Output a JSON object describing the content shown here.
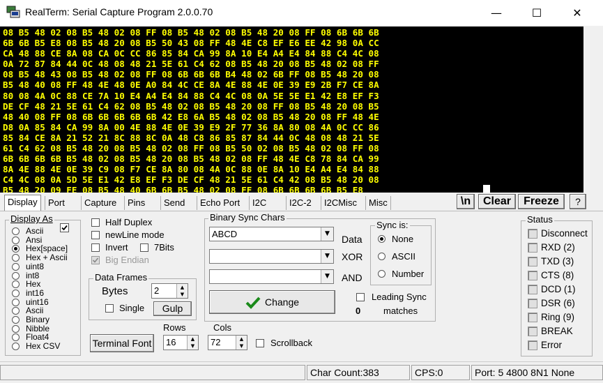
{
  "window": {
    "title": "RealTerm: Serial Capture Program 2.0.0.70",
    "minimize_glyph": "—",
    "maximize_glyph": "☐",
    "close_glyph": "✕"
  },
  "terminal": {
    "lines": [
      "08 B5 48 02 08 B5 48 02 08 FF 08 B5 48 02 08 B5 48 20 08 FF 08 6B 6B 6B",
      "6B 6B B5 E8 08 B5 48 20 08 B5 50 43 08 FF 48 4E C8 EF E6 EE 42 98 0A CC",
      "CA 48 88 CE 8A 08 CA 0C CC 86 85 84 CA 99 8A 10 E4 A4 E4 84 88 C4 4C 08",
      "0A 72 87 84 44 0C 48 08 48 21 5E 61 C4 62 08 B5 48 20 08 B5 48 02 08 FF",
      "08 B5 48 43 08 B5 48 02 08 FF 08 6B 6B 6B B4 48 02 6B FF 08 B5 48 20 08",
      "B5 48 40 08 FF 48 4E 48 0E A0 84 4C CE 8A 4E 88 4E 0E 39 E9 2B F7 CE 8A",
      "80 08 4A 0C 88 CE 7A 10 E4 A4 E4 84 88 C4 4C 08 0A 5E 5E E1 42 E8 EF F3",
      "DE CF 48 21 5E 61 C4 62 08 B5 48 02 08 B5 48 20 08 FF 08 B5 48 20 08 B5",
      "48 40 08 FF 08 6B 6B 6B 6B 6B 42 E8 6A B5 48 02 08 B5 48 20 08 FF 48 4E",
      "D8 0A 85 84 CA 99 8A 00 4E 88 4E 0E 39 E9 2F 77 36 8A 80 08 4A 0C CC 86",
      "85 84 CE 8A 21 52 21 8C 88 8C 0A 48 C8 86 85 87 84 44 0C 48 08 48 21 5E",
      "61 C4 62 08 B5 48 20 08 B5 48 02 08 FF 08 B5 50 02 08 B5 48 02 08 FF 08",
      "6B 6B 6B 6B B5 48 02 08 B5 48 20 08 B5 48 02 08 FF 48 4E C8 78 84 CA 99",
      "8A 4E 88 4E 0E 39 C9 08 F7 CE 8A 80 08 4A 0C 88 0E 8A 10 E4 A4 E4 84 88",
      "C4 4C 08 0A 5D 5E E1 42 E8 EF F3 DE CF 48 21 5E 61 C4 42 08 B5 48 20 08",
      "B5 48 20 09 FE 08 B5 48 40 6B 6B B5 48 02 08 FF 08 6B 6B 6B 6B B5 E8"
    ]
  },
  "tabs": [
    {
      "label": "Display",
      "active": true
    },
    {
      "label": "Port"
    },
    {
      "label": "Capture"
    },
    {
      "label": "Pins"
    },
    {
      "label": "Send"
    },
    {
      "label": "Echo Port"
    },
    {
      "label": "I2C"
    },
    {
      "label": "I2C-2"
    },
    {
      "label": "I2CMisc"
    },
    {
      "label": "Misc"
    }
  ],
  "toolbar": {
    "newline_label": "\\n",
    "clear_label": "Clear",
    "freeze_label": "Freeze",
    "help_label": "?"
  },
  "display_as": {
    "title": "Display As",
    "options": [
      "Ascii",
      "Ansi",
      "Hex[space]",
      "Hex + Ascii",
      "uint8",
      "int8",
      "Hex",
      "int16",
      "uint16",
      "Ascii",
      "Binary",
      "Nibble",
      "Float4",
      "Hex CSV"
    ],
    "selected": "Hex[space]",
    "checkbox_checked": true
  },
  "options": {
    "half_duplex": "Half Duplex",
    "newline_mode": "newLine mode",
    "invert": "Invert",
    "7bits": "7Bits",
    "big_endian": "Big Endian"
  },
  "data_frames": {
    "title": "Data Frames",
    "bytes_label": "Bytes",
    "bytes_value": "2",
    "single_label": "Single",
    "gulp_label": "Gulp"
  },
  "terminal_font_label": "Terminal Font",
  "rows": {
    "label": "Rows",
    "value": "16"
  },
  "cols": {
    "label": "Cols",
    "value": "72"
  },
  "scrollback_label": "Scrollback",
  "binary_sync": {
    "title": "Binary Sync Chars",
    "data_value": "ABCD",
    "data_label": "Data",
    "xor_label": "XOR",
    "and_label": "AND",
    "change_label": "Change",
    "leading_sync_label": "Leading Sync",
    "matches_count": "0",
    "matches_label": "matches"
  },
  "sync_is": {
    "title": "Sync is:",
    "options": [
      "None",
      "ASCII",
      "Number"
    ],
    "selected": "None"
  },
  "status": {
    "title": "Status",
    "items": [
      "Disconnect",
      "RXD (2)",
      "TXD (3)",
      "CTS (8)",
      "DCD (1)",
      "DSR (6)",
      "Ring (9)",
      "BREAK",
      "Error"
    ]
  },
  "statusbar": {
    "char_count": "Char Count:383",
    "cps": "CPS:0",
    "port": "Port: 5 4800 8N1 None"
  }
}
